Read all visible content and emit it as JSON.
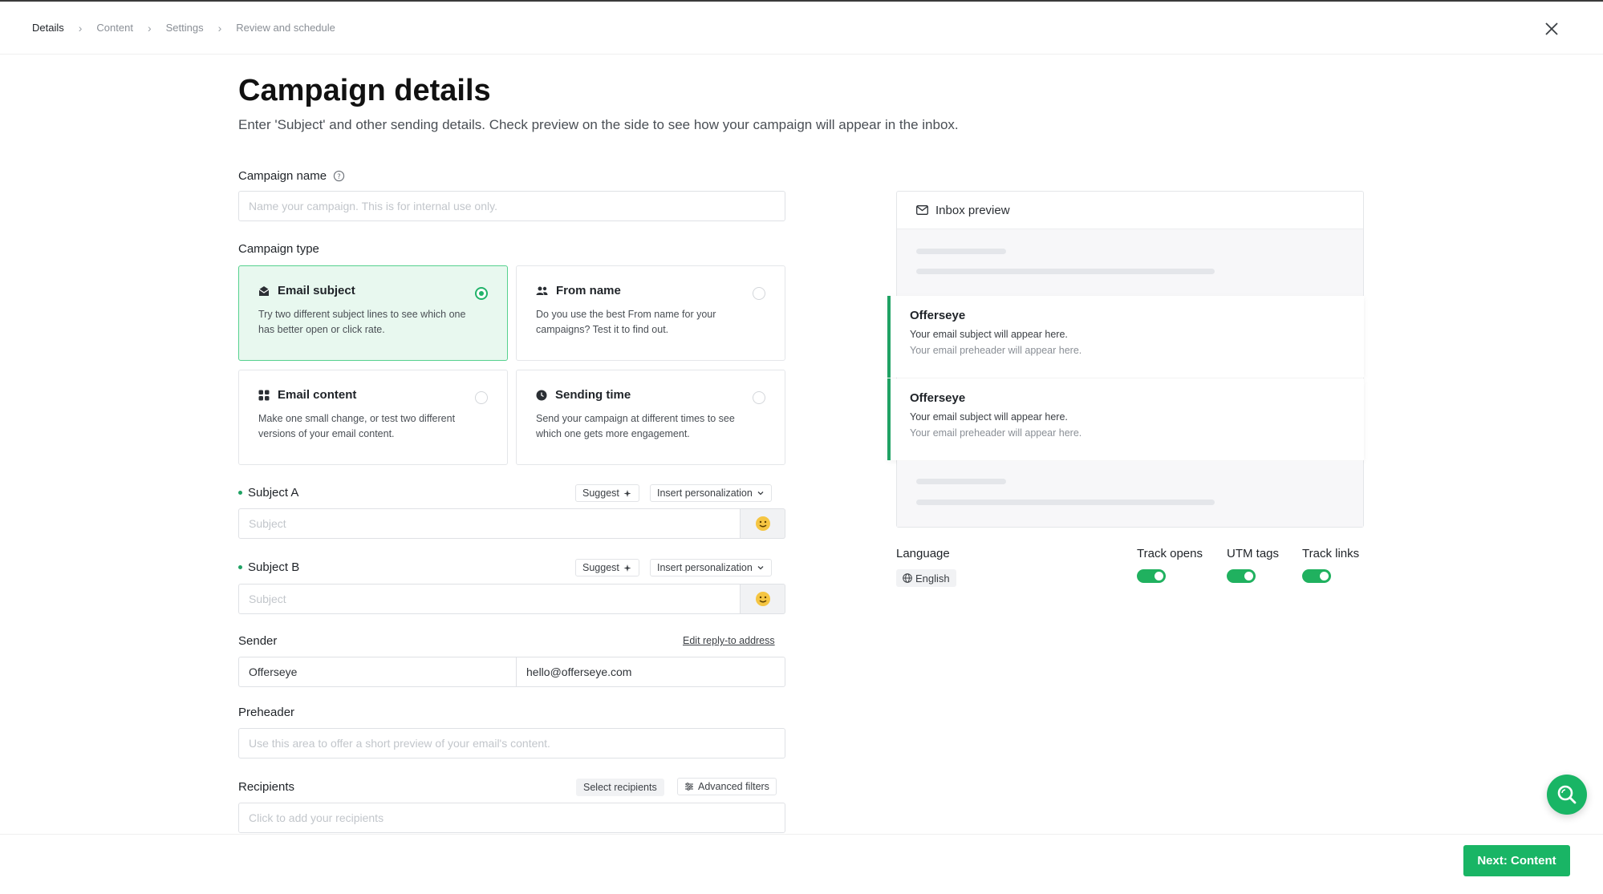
{
  "breadcrumb": [
    {
      "label": "Details",
      "active": true
    },
    {
      "label": "Content",
      "active": false
    },
    {
      "label": "Settings",
      "active": false
    },
    {
      "label": "Review and schedule",
      "active": false
    }
  ],
  "page": {
    "title": "Campaign details",
    "subtitle": "Enter 'Subject' and other sending details. Check preview on the side to see how your campaign will appear in the inbox."
  },
  "campaign_name": {
    "label": "Campaign name",
    "placeholder": "Name your campaign. This is for internal use only."
  },
  "campaign_type": {
    "label": "Campaign type",
    "options": [
      {
        "title": "Email subject",
        "desc": "Try two different subject lines to see which one has better open or click rate.",
        "selected": true
      },
      {
        "title": "From name",
        "desc": "Do you use the best From name for your campaigns? Test it to find out.",
        "selected": false
      },
      {
        "title": "Email content",
        "desc": "Make one small change, or test two different versions of your email content.",
        "selected": false
      },
      {
        "title": "Sending time",
        "desc": "Send your campaign at different times to see which one gets more engagement.",
        "selected": false
      }
    ]
  },
  "subject_a": {
    "label": "Subject A",
    "placeholder": "Subject",
    "suggest": "Suggest",
    "personalize": "Insert personalization"
  },
  "subject_b": {
    "label": "Subject B",
    "placeholder": "Subject",
    "suggest": "Suggest",
    "personalize": "Insert personalization"
  },
  "sender": {
    "label": "Sender",
    "edit_reply": "Edit reply-to address",
    "name": "Offerseye",
    "email": "hello@offerseye.com"
  },
  "preheader": {
    "label": "Preheader",
    "placeholder": "Use this area to offer a short preview of your email's content."
  },
  "recipients": {
    "label": "Recipients",
    "select": "Select recipients",
    "filters": "Advanced filters",
    "placeholder": "Click to add your recipients"
  },
  "preview": {
    "title": "Inbox preview",
    "items": [
      {
        "from": "Offerseye",
        "subject": "Your email subject will appear here.",
        "preheader": "Your email preheader will appear here."
      },
      {
        "from": "Offerseye",
        "subject": "Your email subject will appear here.",
        "preheader": "Your email preheader will appear here."
      }
    ]
  },
  "settings": {
    "language_label": "Language",
    "language_value": "English",
    "track_opens": "Track opens",
    "utm_tags": "UTM tags",
    "track_links": "Track links"
  },
  "footer": {
    "next": "Next: Content"
  },
  "colors": {
    "accent": "#19b565",
    "selected_bg": "#e8f8ef"
  }
}
